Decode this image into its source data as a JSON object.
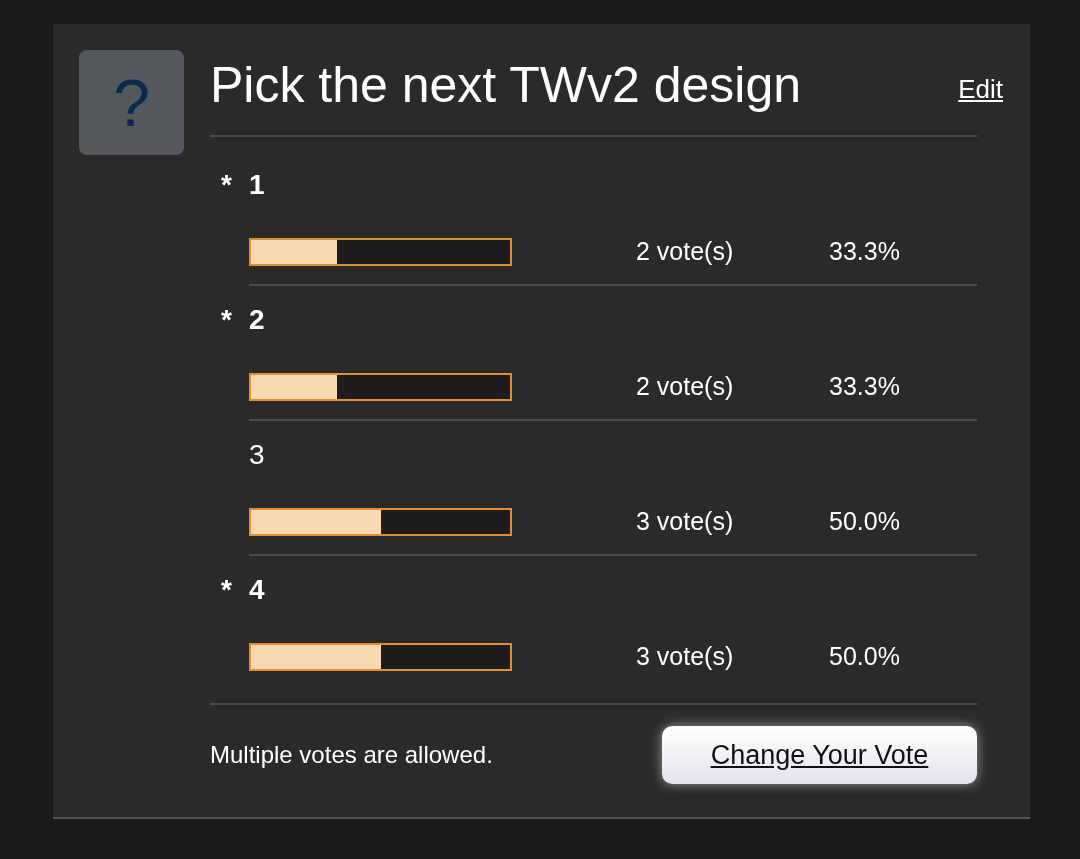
{
  "poll": {
    "icon_text": "?",
    "title": "Pick the next TWv2 design",
    "edit_link": "Edit",
    "selected_marker": "*",
    "options": [
      {
        "label": "1",
        "selected": true,
        "votes": "2 vote(s)",
        "percent": "33.3%",
        "level": 0.333
      },
      {
        "label": "2",
        "selected": true,
        "votes": "2 vote(s)",
        "percent": "33.3%",
        "level": 0.333
      },
      {
        "label": "3",
        "selected": false,
        "votes": "3 vote(s)",
        "percent": "50.0%",
        "level": 0.5
      },
      {
        "label": "4",
        "selected": true,
        "votes": "3 vote(s)",
        "percent": "50.0%",
        "level": 0.5
      }
    ],
    "note": "Multiple votes are allowed.",
    "button": "Change Your Vote"
  }
}
